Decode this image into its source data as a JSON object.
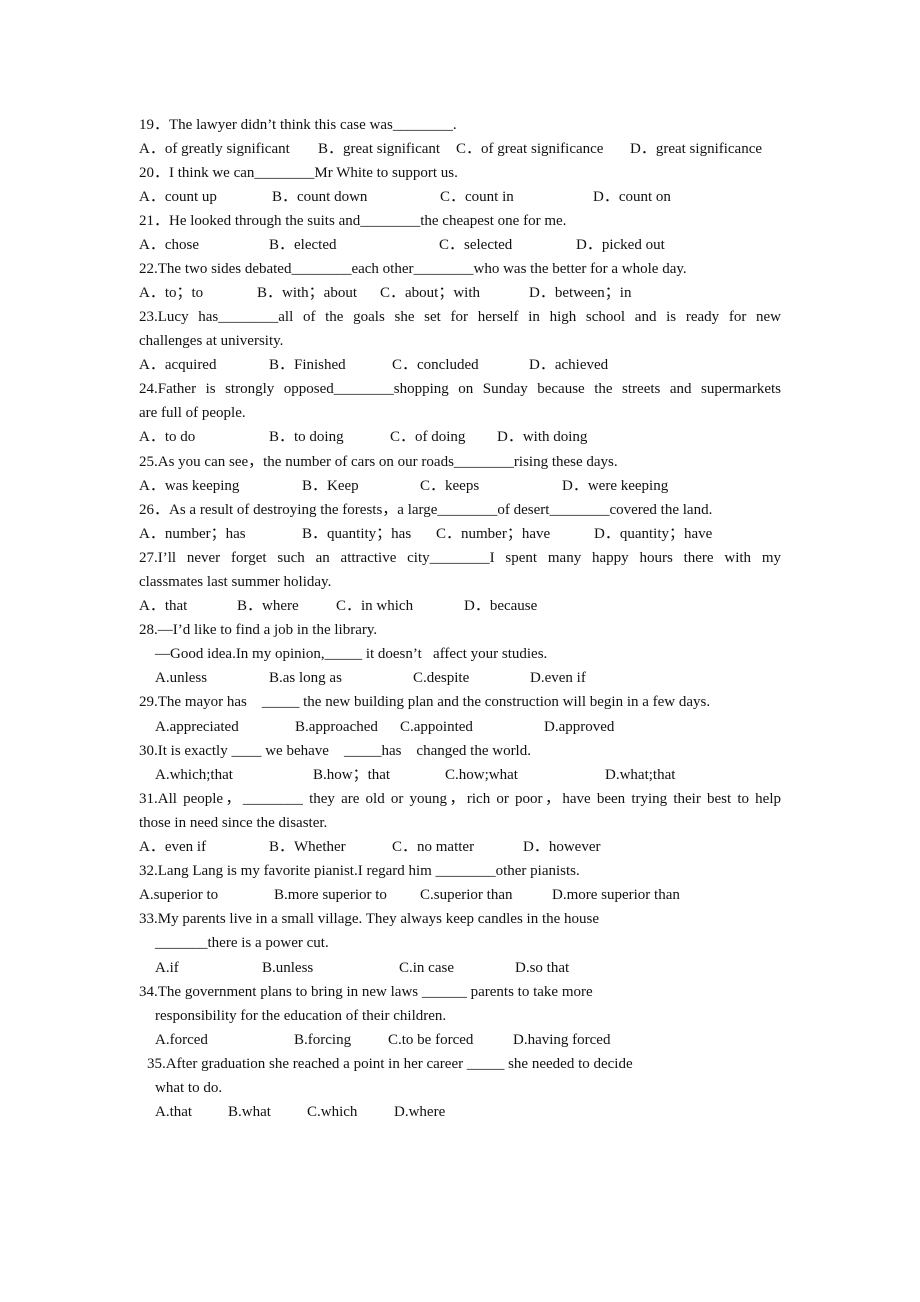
{
  "document": {
    "questions": [
      {
        "number": "19",
        "lines": [
          "19．The lawyer didn’t think this case was________."
        ],
        "options": [
          "A．of greatly significant",
          "B．great significant",
          "C．of great significance",
          "D．great significance"
        ]
      },
      {
        "number": "20",
        "lines": [
          "20．I think we can________Mr White to support us."
        ],
        "options": [
          "A．count up",
          "B．count down",
          "C．count in",
          "D．count on"
        ]
      },
      {
        "number": "21",
        "lines": [
          "21．He looked through the suits and________the cheapest one for me."
        ],
        "options": [
          "A．chose",
          "B．elected",
          "C．selected",
          "D．picked out"
        ]
      },
      {
        "number": "22",
        "lines": [
          "22.The two sides debated________each other________who was the better for a whole day."
        ],
        "options": [
          "A．to；to",
          "B．with；about",
          "C．about；with",
          "D．between；in"
        ]
      },
      {
        "number": "23",
        "lines": [
          "23.Lucy has________all of the goals she set for herself in high school and is ready for new",
          "challenges at university."
        ],
        "options": [
          "A．acquired",
          "B．Finished",
          "C．concluded",
          "D．achieved"
        ]
      },
      {
        "number": "24",
        "lines": [
          "24.Father is strongly opposed________shopping on Sunday because the streets and supermarkets",
          "are full of people."
        ],
        "options": [
          "A．to do",
          "B．to doing",
          "C．of doing",
          "D．with doing"
        ]
      },
      {
        "number": "25",
        "lines": [
          "25.As you can see，the number of cars on our roads________rising these days."
        ],
        "options": [
          "A．was keeping",
          "B．Keep",
          "C．keeps",
          "D．were keeping"
        ]
      },
      {
        "number": "26",
        "lines": [
          "26．As a result of destroying the forests，a large________of desert________covered the land."
        ],
        "options": [
          "A．number；has",
          "B．quantity；has",
          "C．number；have",
          "D．quantity；have"
        ]
      },
      {
        "number": "27",
        "lines": [
          "27.I’ll never forget such an attractive city________I spent many happy hours there with my",
          "classmates last summer holiday."
        ],
        "options": [
          "A．that",
          "B．where",
          "C．in which",
          "D．because"
        ]
      },
      {
        "number": "28",
        "lines": [
          "28.—I’d like to find a job in the library.",
          "—Good idea.In my opinion,_____ it doesn’t   affect your studies."
        ],
        "options": [
          "A.unless",
          "B.as long as",
          "C.despite",
          "D.even if"
        ]
      },
      {
        "number": "29",
        "lines": [
          "29.The mayor has    _____ the new building plan and the construction will begin in a few days."
        ],
        "options": [
          "A.appreciated",
          "B.approached",
          "C.appointed",
          "D.approved"
        ]
      },
      {
        "number": "30",
        "lines": [
          "30.It is exactly ____ we behave    _____has    changed the world."
        ],
        "options": [
          "A.which;that",
          "B.how；that",
          "C.how;what",
          "D.what;that"
        ]
      },
      {
        "number": "31",
        "lines": [
          "31.All people，________ they are old or young，rich or poor，have been trying their best to help",
          "those in need since the disaster."
        ],
        "options": [
          "A．even if",
          "B．Whether",
          "C．no matter",
          "D．however"
        ]
      },
      {
        "number": "32",
        "lines": [
          "32.Lang Lang is my favorite pianist.I regard him ________other pianists."
        ],
        "options": [
          "A.superior to",
          "B.more superior to",
          "C.superior than",
          "D.more superior than"
        ]
      },
      {
        "number": "33",
        "lines": [
          "33.My parents live in a small village. They always keep candles in the house",
          "_______there is a power cut."
        ],
        "options": [
          "A.if",
          "B.unless",
          "C.in case",
          "D.so that"
        ]
      },
      {
        "number": "34",
        "lines": [
          "34.The government plans to bring in new laws ______ parents to take more",
          "responsibility for the education of their children."
        ],
        "options": [
          "A.forced",
          "B.forcing",
          "C.to be forced",
          "D.having forced"
        ]
      },
      {
        "number": "35",
        "lines": [
          "35.After graduation she reached a point in her career _____ she needed to decide",
          "what to do."
        ],
        "options": [
          "A.that",
          "B.what",
          "C.which",
          "D.where"
        ]
      }
    ]
  }
}
